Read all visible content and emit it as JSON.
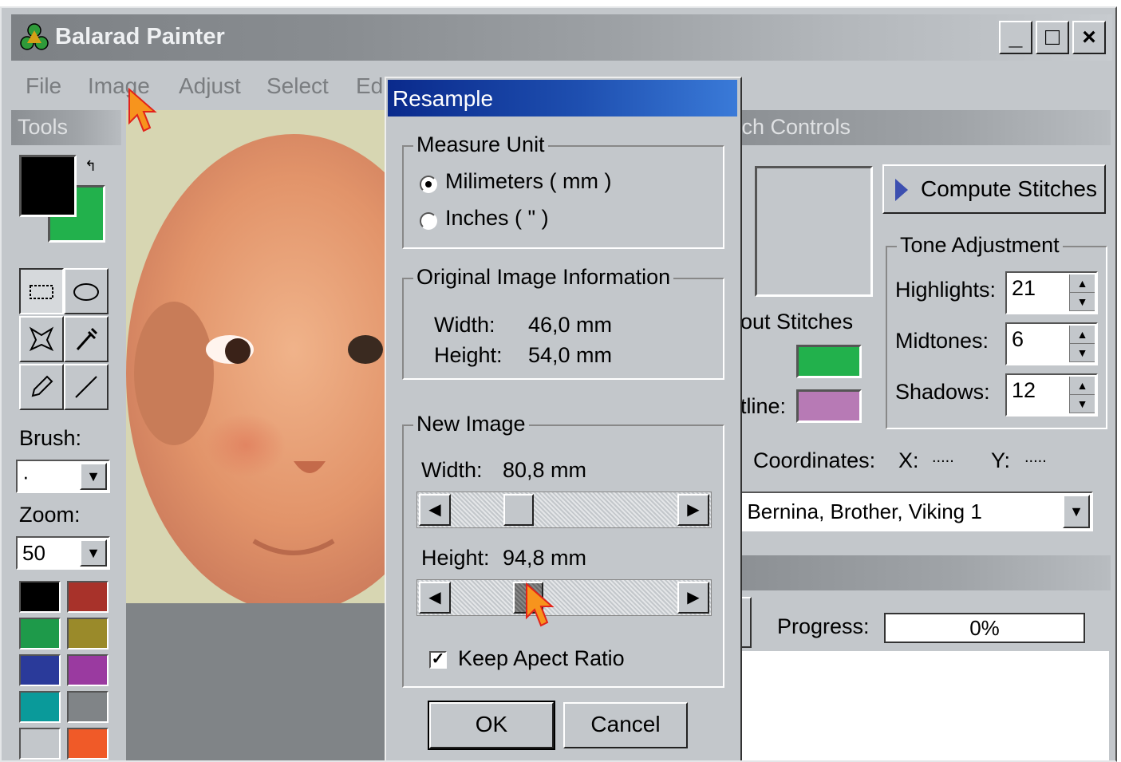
{
  "app": {
    "title": "Balarad Painter",
    "window_buttons": [
      "_",
      "□",
      "×"
    ],
    "menu": [
      "File",
      "Image",
      "Adjust",
      "Select",
      "Ed"
    ]
  },
  "tools": {
    "header": "Tools",
    "brush_label": "Brush:",
    "brush_value": "·",
    "zoom_label": "Zoom:",
    "zoom_value": "50",
    "tool_icons": [
      "rect-select-icon",
      "ellipse-select-icon",
      "lasso-icon",
      "eyedropper-icon",
      "pencil-icon",
      "line-icon"
    ],
    "foreground": "#000000",
    "background": "#22b14c",
    "palette": [
      "#000000",
      "#a8322a",
      "#1e9a4a",
      "#9a8a2a",
      "#2a3a9a",
      "#9a3aa0",
      "#0a9a9a",
      "#808487",
      "#c3c7cb",
      "#f05a28"
    ]
  },
  "stitch": {
    "header": "tch Controls",
    "compute_label": "Compute Stitches",
    "tone_title": "Tone Adjustment",
    "highlights_label": "Highlights:",
    "highlights_value": "21",
    "midtones_label": "Midtones:",
    "midtones_value": "6",
    "shadows_label": "Shadows:",
    "shadows_value": "12",
    "layout_label": "out Stitches",
    "outline_label": "tline:",
    "stitch_color": "#22b14c",
    "outline_color": "#b77ab5",
    "coords_label": "Coordinates:",
    "x_label": "X:",
    "x_value": ".....",
    "y_label": "Y:",
    "y_value": ".....",
    "machine_value": ", Bernina, Brother, Viking   1"
  },
  "lower": {
    "progress_label": "Progress:",
    "progress_value": "0%"
  },
  "dialog": {
    "title": "Resample",
    "measure_title": "Measure Unit",
    "unit_mm": "Milimeters ( mm )",
    "unit_in": "Inches ( \" )",
    "unit_selected": "mm",
    "orig_title": "Original Image Information",
    "orig_width_label": "Width:",
    "orig_width_value": "46,0 mm",
    "orig_height_label": "Height:",
    "orig_height_value": "54,0 mm",
    "new_title": "New Image",
    "new_width_label": "Width:",
    "new_width_value": "80,8 mm",
    "new_height_label": "Height:",
    "new_height_value": "94,8 mm",
    "keep_ratio_label": "Keep Apect Ratio",
    "keep_ratio_checked": true,
    "ok_label": "OK",
    "cancel_label": "Cancel"
  }
}
